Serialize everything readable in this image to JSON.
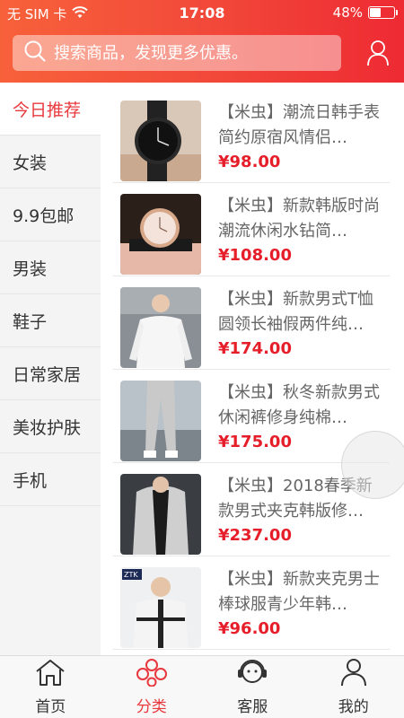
{
  "status_bar": {
    "carrier": "无 SIM 卡",
    "time": "17:08",
    "battery": "48%",
    "battery_level": 0.48
  },
  "search": {
    "placeholder": "搜索商品，发现更多优惠。"
  },
  "sidebar": {
    "items": [
      {
        "label": "今日推荐",
        "active": true
      },
      {
        "label": "女装"
      },
      {
        "label": "9.9包邮"
      },
      {
        "label": "男装"
      },
      {
        "label": "鞋子"
      },
      {
        "label": "日常家居"
      },
      {
        "label": "美妆护肤"
      },
      {
        "label": "手机"
      }
    ]
  },
  "products": [
    {
      "title": "【米虫】潮流日韩手表简约原宿风情侣…",
      "price": "¥98.00"
    },
    {
      "title": "【米虫】新款韩版时尚潮流休闲水钻简…",
      "price": "¥108.00"
    },
    {
      "title": "【米虫】新款男式T恤圆领长袖假两件纯…",
      "price": "¥174.00"
    },
    {
      "title": "【米虫】秋冬新款男式休闲裤修身纯棉…",
      "price": "¥175.00"
    },
    {
      "title": "【米虫】2018春季新款男式夹克韩版修…",
      "price": "¥237.00"
    },
    {
      "title": "【米虫】新款夹克男士棒球服青少年韩…",
      "price": "¥96.00"
    }
  ],
  "tabbar": {
    "items": [
      {
        "label": "首页",
        "icon": "home-icon"
      },
      {
        "label": "分类",
        "icon": "category-icon",
        "active": true
      },
      {
        "label": "客服",
        "icon": "customer-service-icon"
      },
      {
        "label": "我的",
        "icon": "profile-icon"
      }
    ]
  },
  "colors": {
    "accent": "#e8383d",
    "price": "#e61e2a",
    "header_start": "#f7613a",
    "header_end": "#ee2a33"
  }
}
